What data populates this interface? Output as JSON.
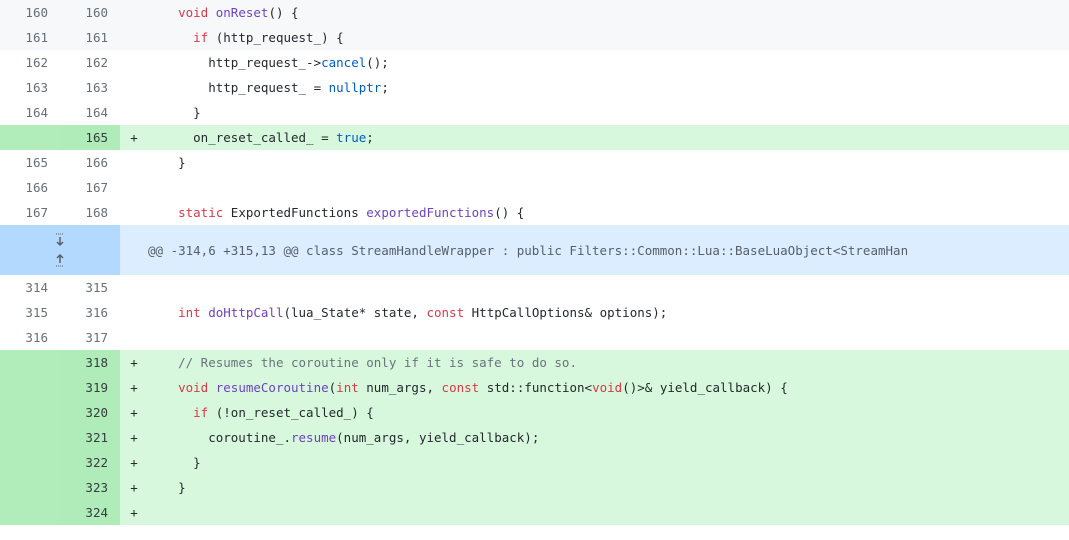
{
  "rows_top": [
    {
      "old": "160",
      "new": "160",
      "marker": "",
      "type": "ctx",
      "shaded": true,
      "code": [
        {
          "t": "    "
        },
        {
          "t": "void",
          "c": "kw"
        },
        {
          "t": " "
        },
        {
          "t": "onReset",
          "c": "fn"
        },
        {
          "t": "() {"
        }
      ]
    },
    {
      "old": "161",
      "new": "161",
      "marker": "",
      "type": "ctx",
      "shaded": true,
      "code": [
        {
          "t": "      "
        },
        {
          "t": "if",
          "c": "kw"
        },
        {
          "t": " (http_request_) {"
        }
      ]
    },
    {
      "old": "162",
      "new": "162",
      "marker": "",
      "type": "ctx",
      "shaded": false,
      "code": [
        {
          "t": "        http_request_->"
        },
        {
          "t": "cancel",
          "c": "cn"
        },
        {
          "t": "();"
        }
      ]
    },
    {
      "old": "163",
      "new": "163",
      "marker": "",
      "type": "ctx",
      "shaded": false,
      "code": [
        {
          "t": "        http_request_ = "
        },
        {
          "t": "nullptr",
          "c": "cn"
        },
        {
          "t": ";"
        }
      ]
    },
    {
      "old": "164",
      "new": "164",
      "marker": "",
      "type": "ctx",
      "shaded": false,
      "code": [
        {
          "t": "      }"
        }
      ]
    },
    {
      "old": "",
      "new": "165",
      "marker": "+",
      "type": "add",
      "shaded": false,
      "code": [
        {
          "t": "      on_reset_called_ = "
        },
        {
          "t": "true",
          "c": "cn"
        },
        {
          "t": ";"
        }
      ]
    },
    {
      "old": "165",
      "new": "166",
      "marker": "",
      "type": "ctx",
      "shaded": false,
      "code": [
        {
          "t": "    }"
        }
      ]
    },
    {
      "old": "166",
      "new": "167",
      "marker": "",
      "type": "ctx",
      "shaded": false,
      "code": [
        {
          "t": ""
        }
      ]
    },
    {
      "old": "167",
      "new": "168",
      "marker": "",
      "type": "ctx",
      "shaded": false,
      "code": [
        {
          "t": "    "
        },
        {
          "t": "static",
          "c": "kw"
        },
        {
          "t": " ExportedFunctions "
        },
        {
          "t": "exportedFunctions",
          "c": "fn"
        },
        {
          "t": "() {"
        }
      ]
    }
  ],
  "hunk": {
    "header": "@@ -314,6 +315,13 @@ class StreamHandleWrapper : public Filters::Common::Lua::BaseLuaObject<StreamHan",
    "expand_down_icon": "fold-down-icon",
    "expand_up_icon": "fold-up-icon"
  },
  "rows_bottom": [
    {
      "old": "314",
      "new": "315",
      "marker": "",
      "type": "ctx",
      "code": [
        {
          "t": ""
        }
      ]
    },
    {
      "old": "315",
      "new": "316",
      "marker": "",
      "type": "ctx",
      "code": [
        {
          "t": "    "
        },
        {
          "t": "int",
          "c": "kw"
        },
        {
          "t": " "
        },
        {
          "t": "doHttpCall",
          "c": "fn"
        },
        {
          "t": "(lua_State* state, "
        },
        {
          "t": "const",
          "c": "kw"
        },
        {
          "t": " HttpCallOptions& options);"
        }
      ]
    },
    {
      "old": "316",
      "new": "317",
      "marker": "",
      "type": "ctx",
      "code": [
        {
          "t": ""
        }
      ]
    },
    {
      "old": "",
      "new": "318",
      "marker": "+",
      "type": "add",
      "code": [
        {
          "t": "    "
        },
        {
          "t": "// Resumes the coroutine only if it is safe to do so.",
          "c": "cm"
        }
      ]
    },
    {
      "old": "",
      "new": "319",
      "marker": "+",
      "type": "add",
      "code": [
        {
          "t": "    "
        },
        {
          "t": "void",
          "c": "kw"
        },
        {
          "t": " "
        },
        {
          "t": "resumeCoroutine",
          "c": "fn"
        },
        {
          "t": "("
        },
        {
          "t": "int",
          "c": "kw"
        },
        {
          "t": " num_args, "
        },
        {
          "t": "const",
          "c": "kw"
        },
        {
          "t": " std::function<"
        },
        {
          "t": "void",
          "c": "kw"
        },
        {
          "t": "()>& yield_callback) {"
        }
      ]
    },
    {
      "old": "",
      "new": "320",
      "marker": "+",
      "type": "add",
      "code": [
        {
          "t": "      "
        },
        {
          "t": "if",
          "c": "kw"
        },
        {
          "t": " (!on_reset_called_) {"
        }
      ]
    },
    {
      "old": "",
      "new": "321",
      "marker": "+",
      "type": "add",
      "code": [
        {
          "t": "        coroutine_."
        },
        {
          "t": "resume",
          "c": "fn"
        },
        {
          "t": "(num_args, yield_callback);"
        }
      ]
    },
    {
      "old": "",
      "new": "322",
      "marker": "+",
      "type": "add",
      "code": [
        {
          "t": "      }"
        }
      ]
    },
    {
      "old": "",
      "new": "323",
      "marker": "+",
      "type": "add",
      "code": [
        {
          "t": "    }"
        }
      ]
    },
    {
      "old": "",
      "new": "324",
      "marker": "+",
      "type": "add",
      "code": [
        {
          "t": ""
        }
      ]
    }
  ]
}
